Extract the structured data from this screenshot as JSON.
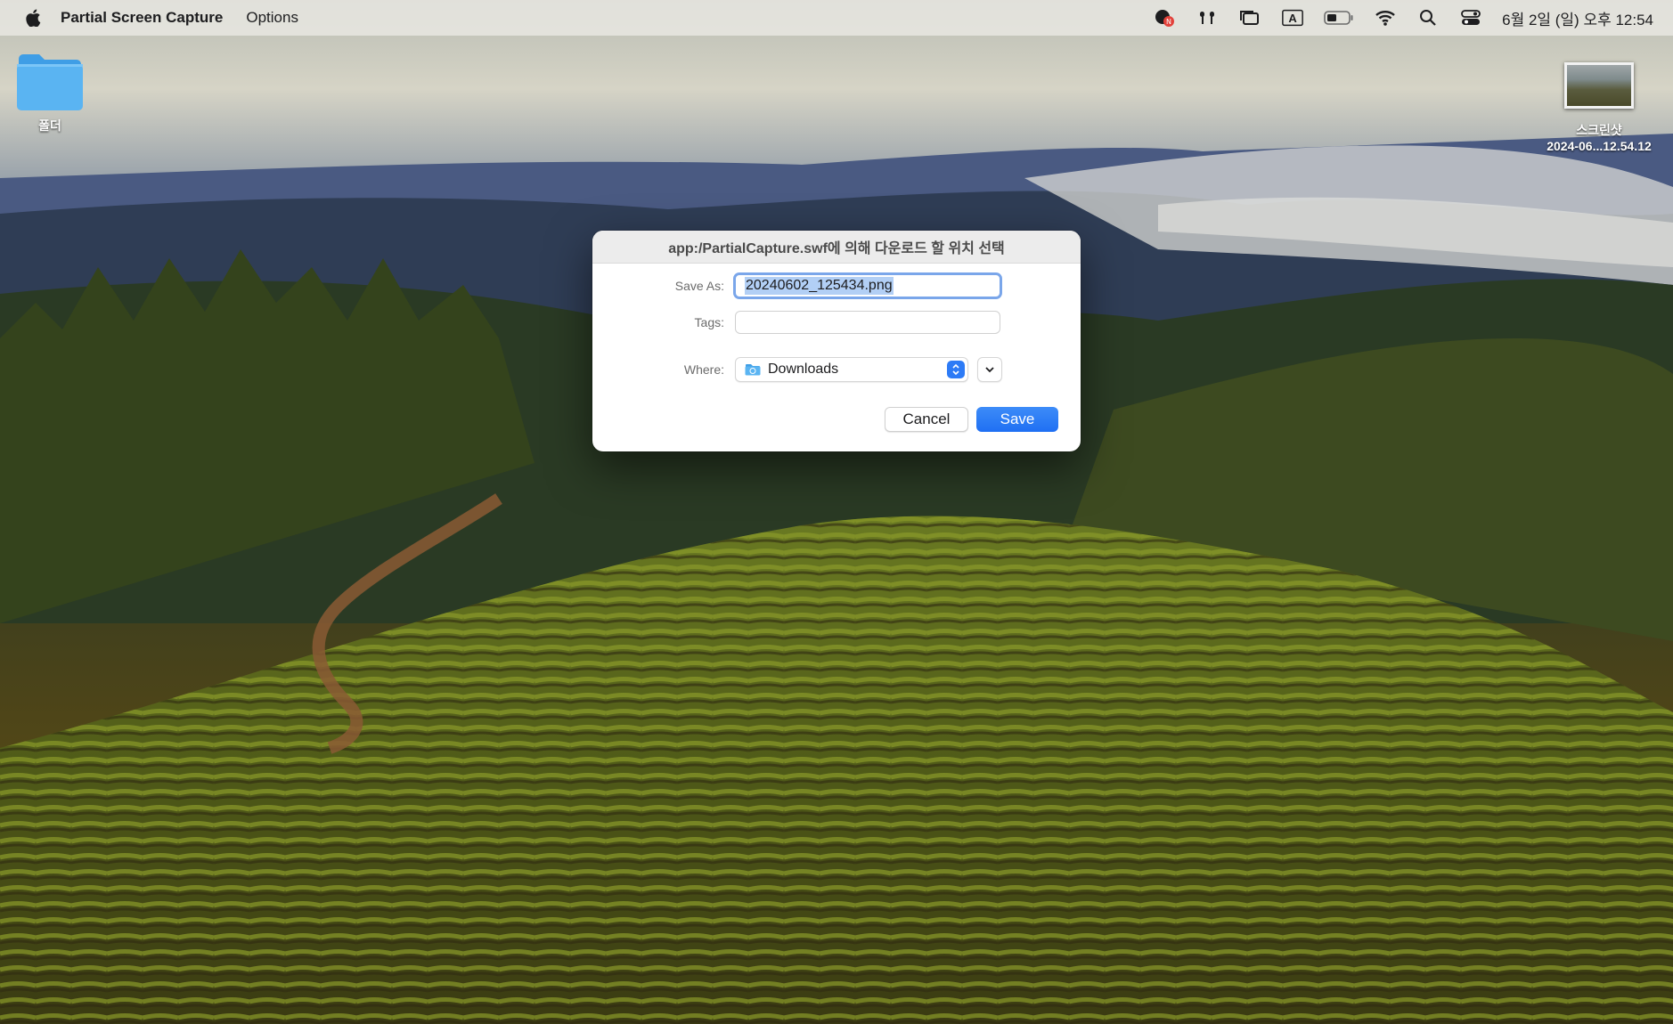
{
  "menubar": {
    "app_name": "Partial Screen Capture",
    "menus": [
      "Options"
    ],
    "status_icons": [
      "notification-app-icon",
      "airpods-icon",
      "stage-manager-icon",
      "input-source-icon",
      "battery-icon",
      "wifi-icon",
      "spotlight-icon",
      "control-center-icon"
    ],
    "input_source_label": "A",
    "clock": "6월 2일 (일) 오후 12:54"
  },
  "desktop": {
    "folder_label": "폴더",
    "screenshot_label_line1": "스크린샷",
    "screenshot_label_line2": "2024-06...12.54.12"
  },
  "dialog": {
    "title": "app:/PartialCapture.swf에 의해 다운로드 할 위치 선택",
    "save_as_label": "Save As:",
    "save_as_value": "20240602_125434.png",
    "tags_label": "Tags:",
    "tags_value": "",
    "where_label": "Where:",
    "where_value": "Downloads",
    "cancel_label": "Cancel",
    "save_label": "Save"
  },
  "colors": {
    "accent": "#2d7bf6",
    "selection": "#b2cff5",
    "folder_blue": "#5ab4f2"
  }
}
